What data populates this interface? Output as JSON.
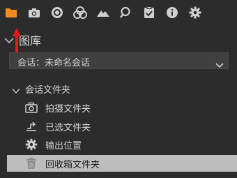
{
  "toolbar": {
    "icons": [
      "folder-icon",
      "camera-icon",
      "lens-icon",
      "color-circles-icon",
      "landscape-icon",
      "search-icon",
      "clipboard-icon",
      "info-icon",
      "gear-icon"
    ],
    "active_color": "#f28c1e"
  },
  "library": {
    "title": "图库",
    "session_select": "会话：未命名会话",
    "group_label": "会话文件夹",
    "items": [
      {
        "label": "拍摄文件夹",
        "icon": "camera-icon"
      },
      {
        "label": "已选文件夹",
        "icon": "selects-icon"
      },
      {
        "label": "输出位置",
        "icon": "gear-icon"
      },
      {
        "label": "回收箱文件夹",
        "icon": "trash-icon"
      }
    ],
    "selected_index": 3
  },
  "annotation": {
    "arrow_color": "#e01b1b"
  }
}
